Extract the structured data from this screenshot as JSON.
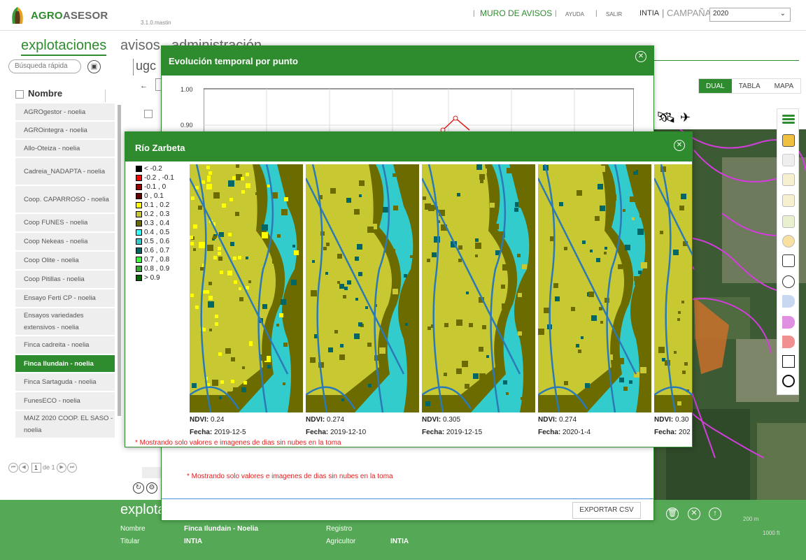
{
  "app": {
    "brand_a": "AGRO",
    "brand_b": "ASESOR",
    "version": "3.1.0.mastin"
  },
  "topnav": {
    "muro": "MURO DE AVISOS",
    "ayuda": "AYUDA",
    "salir": "SALIR",
    "org": "INTIA",
    "campana_label": "CAMPAÑA",
    "campana_value": "2020"
  },
  "tabs": [
    "explotaciones",
    "avisos",
    "administración"
  ],
  "search": {
    "placeholder": "Búsqueda rápida"
  },
  "ugc_text": "ugc",
  "list": {
    "header": "Nombre",
    "items": [
      "AGROgestor - noelia",
      "AGROintegra - noelia",
      "Allo-Oteiza - noelia",
      "Cadreia_NADAPTA - noelia",
      "Coop. CAPARROSO - noelia",
      "Coop FUNES - noelia",
      "Coop Nekeas - noelia",
      "Coop Olite - noelia",
      "Coop Pitillas - noelia",
      "Ensayo Ferti CP - noelia",
      "Ensayos variedades extensivos - noelia",
      "Finca cadreita - noelia",
      "Finca Ilundain - noelia",
      "Finca Sartaguda - noelia",
      "FunesECO - noelia",
      "MAIZ 2020 COOP. EL SASO - noelia"
    ],
    "selected_index": 12
  },
  "pager": {
    "page": "1",
    "of": "de 1"
  },
  "view_toggle": [
    "DUAL",
    "TABLA",
    "MAPA"
  ],
  "footer": {
    "title": "explotación",
    "nombre_label": "Nombre",
    "nombre_value": "Finca Ilundain - Noelia",
    "titular_label": "Titular",
    "titular_value": "INTIA",
    "registro_label": "Registro",
    "agricultor_label": "Agricultor",
    "agricultor_value": "INTIA",
    "scale1": "200 m",
    "scale2": "1000 ft"
  },
  "modal1": {
    "title": "Evolución temporal por punto",
    "y_ticks": [
      "1.00",
      "0.90"
    ],
    "note": "* Mostrando solo valores e imagenes de dias sin nubes en la toma",
    "export": "EXPORTAR CSV"
  },
  "modal2": {
    "title": "Río Zarbeta",
    "legend": [
      {
        "label": "< -0.2",
        "color": "#000000"
      },
      {
        "label": "-0.2 , -0.1",
        "color": "#ff0000"
      },
      {
        "label": "-0.1 , 0",
        "color": "#990000"
      },
      {
        "label": "0 , 0.1",
        "color": "#660000"
      },
      {
        "label": "0.1 , 0.2",
        "color": "#ffff00"
      },
      {
        "label": "0.2 , 0.3",
        "color": "#c8c832"
      },
      {
        "label": "0.3 , 0.4",
        "color": "#6b6b00"
      },
      {
        "label": "0.4 , 0.5",
        "color": "#33ffff"
      },
      {
        "label": "0.5 , 0.6",
        "color": "#33cccc"
      },
      {
        "label": "0.6 , 0.7",
        "color": "#006666"
      },
      {
        "label": "0.7 , 0.8",
        "color": "#33ff33"
      },
      {
        "label": "0.8 , 0.9",
        "color": "#33aa33"
      },
      {
        "label": "> 0.9",
        "color": "#006600"
      }
    ],
    "tiles": [
      {
        "ndvi_label": "NDVI:",
        "ndvi": "0.24",
        "fecha_label": "Fecha:",
        "fecha": "2019-12-5"
      },
      {
        "ndvi_label": "NDVI:",
        "ndvi": "0.274",
        "fecha_label": "Fecha:",
        "fecha": "2019-12-10"
      },
      {
        "ndvi_label": "NDVI:",
        "ndvi": "0.305",
        "fecha_label": "Fecha:",
        "fecha": "2019-12-15"
      },
      {
        "ndvi_label": "NDVI:",
        "ndvi": "0.274",
        "fecha_label": "Fecha:",
        "fecha": "2020-1-4"
      },
      {
        "ndvi_label": "NDVI:",
        "ndvi": "0.30",
        "fecha_label": "Fecha:",
        "fecha": "202"
      }
    ],
    "note": "* Mostrando solo valores e imagenes de dias sin nubes en la toma"
  }
}
